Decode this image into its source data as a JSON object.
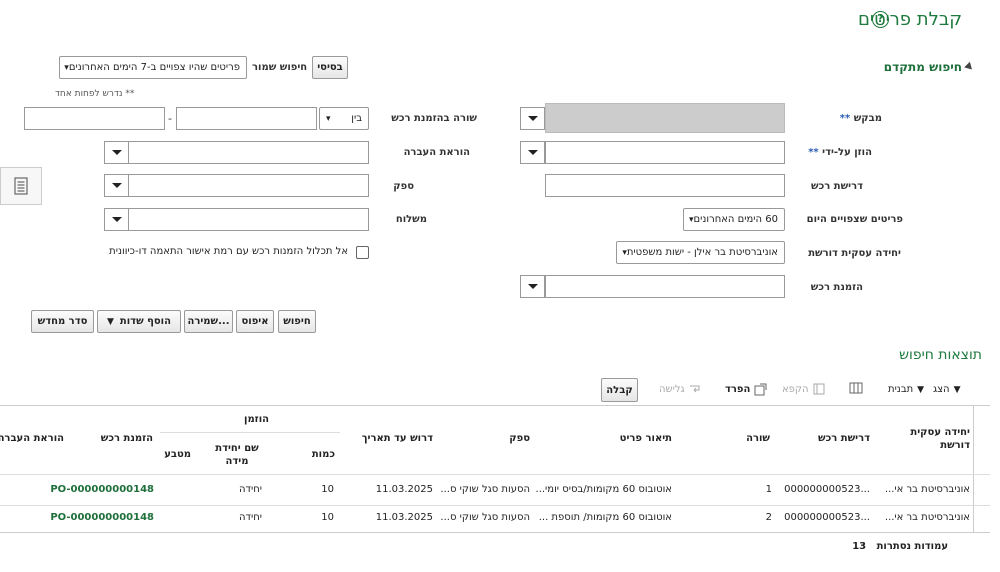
{
  "header": {
    "title": "קבלת פריטים",
    "help_icon": "?"
  },
  "advanced": {
    "title": "חיפוש מתקדם"
  },
  "saved_search": {
    "basic_button": "בסיסי",
    "label": "חיפוש שמור",
    "value": "פריטים שהיו צפויים ב-7 הימים האחרונים"
  },
  "note": "** נדרש לפחות אחד",
  "fields": {
    "requester": "מבקש",
    "entered_by": "הוזן על-ידי",
    "requisition": "דרישת רכש",
    "expected_items": "פריטים שצפויים היום",
    "expected_items_value": "60 הימים האחרונים",
    "business_unit": "יחידה עסקית דורשת",
    "business_unit_value": "אוניברסיטת בר אילן - ישות משפטית",
    "po": "הזמנת רכש",
    "po_line": "שורה בהזמנת רכש",
    "between": "בין",
    "dash": "-",
    "transfer_order": "הוראת העברה",
    "supplier": "ספק",
    "shipment": "משלוח",
    "exclude_checkbox": "אל תכלול הזמנות רכש עם רמת אישור התאמה דו-כיוונית"
  },
  "actions": {
    "search": "חיפוש",
    "reset": "איפוס",
    "save": "שמירה...",
    "add_fields": "הוסף שדות",
    "reorder": "סדר מחדש"
  },
  "results": {
    "title": "תוצאות חיפוש",
    "toolbar": {
      "view": "הצג",
      "format": "תבנית",
      "freeze": "הקפא",
      "detach": "הפרד",
      "wrap": "גלישה",
      "receive": "קבלה"
    },
    "headers": {
      "bu": "יחידה עסקית דורשת",
      "requisition": "דרישת רכש",
      "line": "שורה",
      "item_desc": "תיאור פריט",
      "supplier": "ספק",
      "due_date": "דרוש עד תאריך",
      "ordered": "הוזמן",
      "qty": "כמות",
      "uom": "שם יחידת מידה",
      "currency": "מטבע",
      "po": "הזמנת רכש",
      "transfer": "הוראת העברה"
    },
    "rows": [
      {
        "bu": "אוניברסיטת בר אי...",
        "requisition": "...000000000523",
        "line": "1",
        "item_desc": "אוטובוס 60 מקומות/בסיס יומי...",
        "supplier": "הסעות סגל שוקי ס...",
        "due_date": "11.03.2025",
        "qty": "10",
        "uom": "יחידה",
        "currency": "",
        "po": "PO-000000000148",
        "transfer": ""
      },
      {
        "bu": "אוניברסיטת בר אי...",
        "requisition": "...000000000523",
        "line": "2",
        "item_desc": "אוטובוס 60 מקומות/ תוספת ...",
        "supplier": "הסעות סגל שוקי ס...",
        "due_date": "11.03.2025",
        "qty": "10",
        "uom": "יחידה",
        "currency": "",
        "po": "PO-000000000148",
        "transfer": ""
      }
    ],
    "hidden_columns_label": "עמודות נסתרות",
    "hidden_columns_count": "13"
  }
}
